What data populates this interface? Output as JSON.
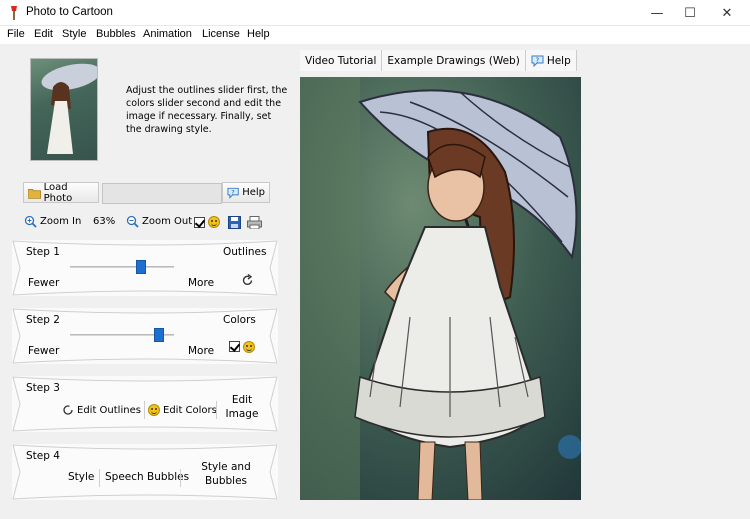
{
  "window": {
    "title": "Photo to Cartoon",
    "controls": {
      "minimize": "—",
      "maximize": "☐",
      "close": "✕"
    }
  },
  "menu": [
    "File",
    "Edit",
    "Style",
    "Bubbles",
    "Animation",
    "License",
    "Help"
  ],
  "instructions": "Adjust the outlines slider first, the colors slider second and edit the image if necessary. Finally, set the drawing style.",
  "toolbar1": {
    "load_photo": "Load Photo",
    "photo_path": "",
    "help": "Help"
  },
  "toolbar2": {
    "zoom_in": "Zoom In",
    "zoom_level": "63%",
    "zoom_out": "Zoom Out"
  },
  "steps": {
    "step1": {
      "title": "Step 1",
      "name": "Outlines",
      "fewer": "Fewer",
      "more": "More",
      "slider_value": 0.68
    },
    "step2": {
      "title": "Step 2",
      "name": "Colors",
      "fewer": "Fewer",
      "more": "More",
      "slider_value": 0.86
    },
    "step3": {
      "title": "Step 3",
      "edit_outlines": "Edit Outlines",
      "edit_colors": "Edit Colors",
      "edit_image": "Edit Image"
    },
    "step4": {
      "title": "Step 4",
      "style": "Style",
      "speech_bubbles": "Speech Bubbles",
      "style_and_bubbles": "Style and Bubbles"
    }
  },
  "right_tabs": {
    "video_tutorial": "Video Tutorial",
    "example_drawings": "Example Drawings (Web)",
    "help": "Help"
  },
  "colors": {
    "slider_accent": "#1e6fd0",
    "background": "#f0f0f0"
  },
  "icons": [
    "app-icon",
    "folder-icon",
    "help-icon",
    "zoom-in-icon",
    "zoom-out-icon",
    "smiley-icon",
    "save-icon",
    "print-icon",
    "refresh-icon"
  ]
}
